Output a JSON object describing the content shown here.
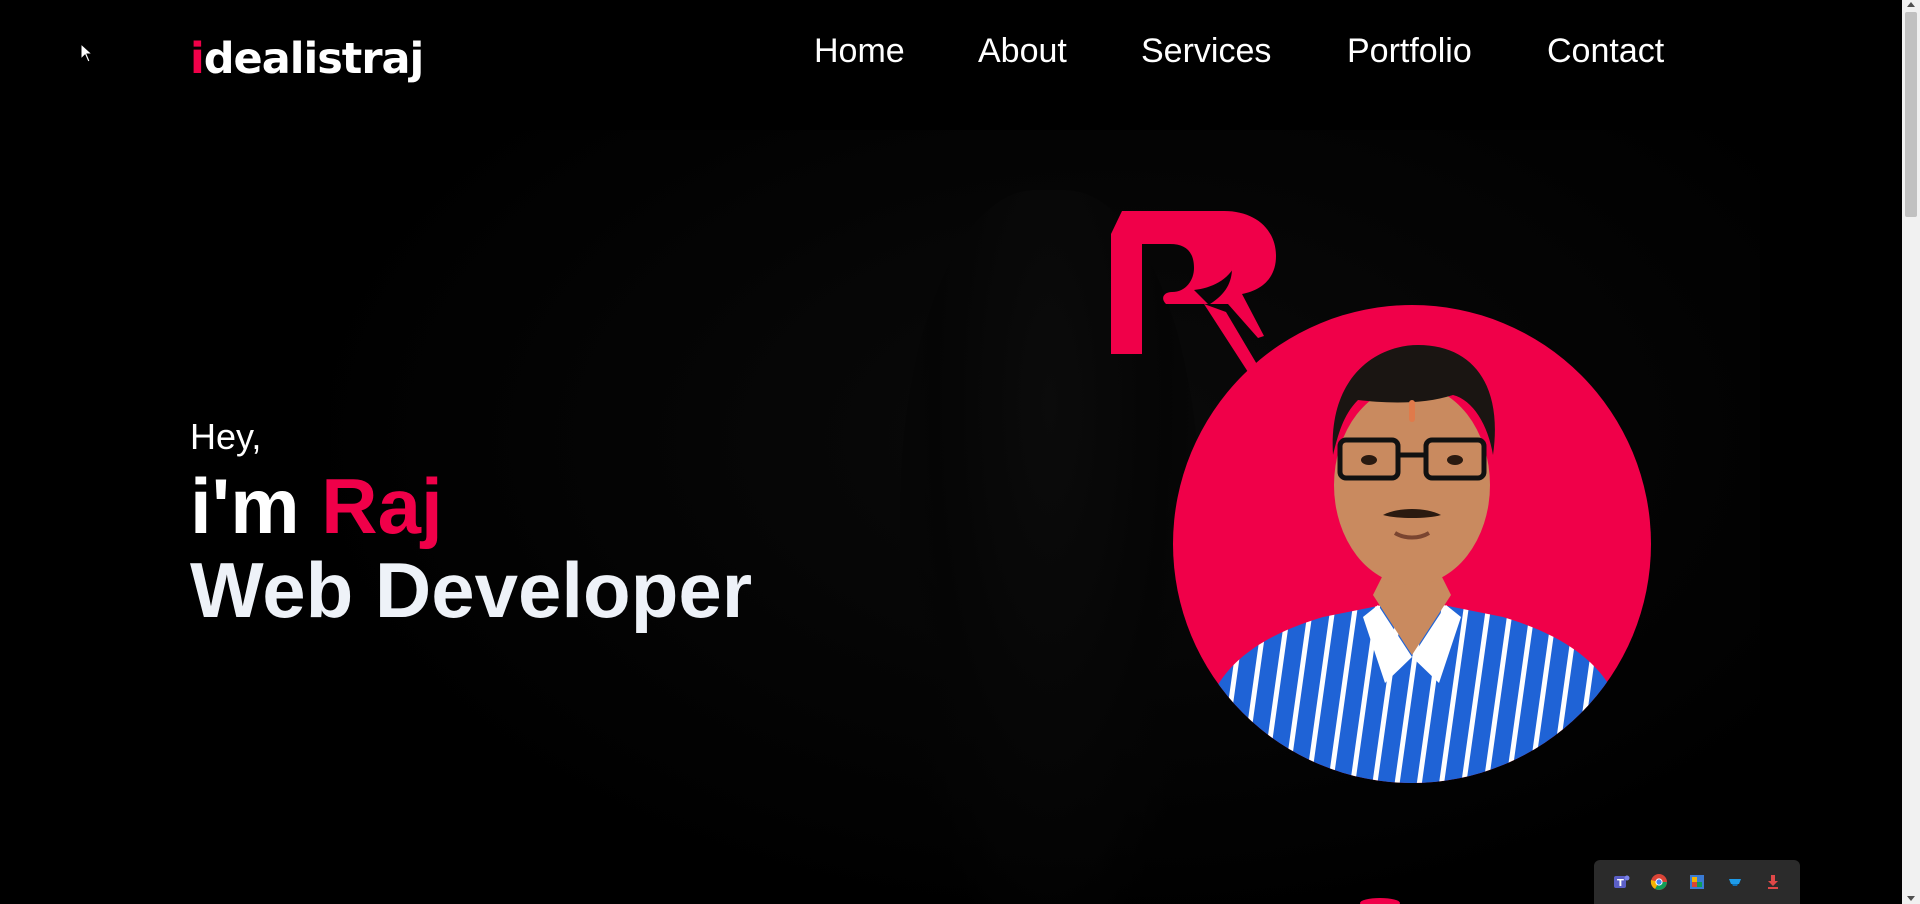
{
  "brand": {
    "logo_accent": "i",
    "logo_rest": "dealistraj",
    "accent_color": "#f00049"
  },
  "nav": {
    "items": [
      {
        "label": "Home"
      },
      {
        "label": "About"
      },
      {
        "label": "Services"
      },
      {
        "label": "Portfolio"
      },
      {
        "label": "Contact"
      }
    ]
  },
  "hero": {
    "greeting": "Hey,",
    "intro_prefix": "i'm ",
    "name": "Raj",
    "role": "Web Developer"
  },
  "tray": {
    "icons": [
      "teams-icon",
      "chrome-icon",
      "photos-icon",
      "mail-icon",
      "download-icon"
    ]
  }
}
